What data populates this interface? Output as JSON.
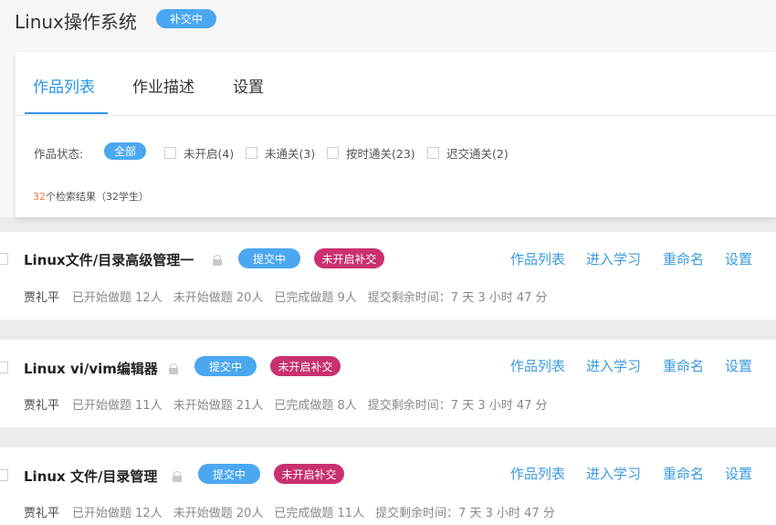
{
  "course": {
    "title": "Linux操作系统",
    "status_badge": "补交中"
  },
  "tabs": [
    {
      "label": "作品列表",
      "active": true
    },
    {
      "label": "作业描述",
      "active": false
    },
    {
      "label": "设置",
      "active": false
    }
  ],
  "filter": {
    "label": "作品状态:",
    "all_label": "全部",
    "options": [
      "未开启(4)",
      "未通关(3)",
      "按时通关(23)",
      "迟交通关(2)"
    ]
  },
  "results": {
    "count": "32",
    "text": "个检索结果（32学生）"
  },
  "assignments": [
    {
      "title": "Linux文件/目录高级管理一",
      "status": "提交中",
      "late_status": "未开启补交",
      "actions": [
        "作品列表",
        "进入学习",
        "重命名",
        "设置"
      ],
      "teacher": "贾礼平",
      "stats": [
        "已开始做题 12人",
        "未开始做题 20人",
        "已完成做题 9人"
      ],
      "remaining": "提交剩余时间：7 天 3 小时 47 分"
    },
    {
      "title": "Linux vi/vim编辑器",
      "status": "提交中",
      "late_status": "未开启补交",
      "actions": [
        "作品列表",
        "进入学习",
        "重命名",
        "设置"
      ],
      "teacher": "贾礼平",
      "stats": [
        "已开始做题 11人",
        "未开始做题 21人",
        "已完成做题 8人"
      ],
      "remaining": "提交剩余时间：7 天 3 小时 47 分"
    },
    {
      "title": "Linux 文件/目录管理",
      "status": "提交中",
      "late_status": "未开启补交",
      "actions": [
        "作品列表",
        "进入学习",
        "重命名",
        "设置"
      ],
      "teacher": "贾礼平",
      "stats": [
        "已开始做题 12人",
        "未开始做题 20人",
        "已完成做题 11人"
      ],
      "remaining": "提交剩余时间：7 天 3 小时 47 分"
    }
  ],
  "colors": {
    "accent": "#2a94e6",
    "badge_blue": "#4aa7f0",
    "badge_pink": "#c9306f",
    "result_count": "#ff7a3d"
  }
}
